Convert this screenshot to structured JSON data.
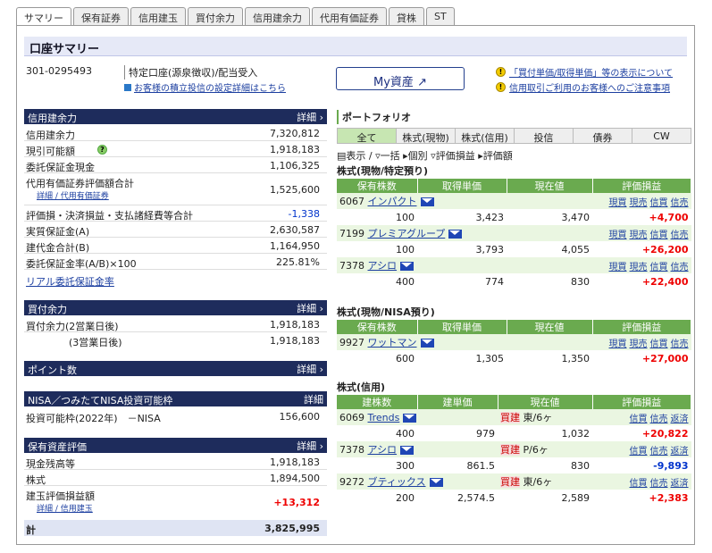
{
  "tabs": [
    "サマリー",
    "保有証券",
    "信用建玉",
    "買付余力",
    "信用建余力",
    "代用有価証券",
    "貸株",
    "ST"
  ],
  "title": "口座サマリー",
  "account": {
    "number": "301-0295493",
    "tax": "特定口座(源泉徴収)/配当受入",
    "tax_link": "お客様の積立投信の設定詳細はこちら"
  },
  "myasset": "My資産",
  "notes": [
    "「買付単価/取得単価」等の表示について",
    "信用取引ご利用のお客様へのご注意事項"
  ],
  "detail": "詳細",
  "margin": {
    "header": "信用建余力",
    "rows": [
      {
        "label": "信用建余力",
        "value": "7,320,812"
      },
      {
        "label": "現引可能額",
        "value": "1,918,183"
      },
      {
        "label": "委託保証金現金",
        "value": "1,106,325"
      },
      {
        "label": "代用有価証券評価額合計",
        "value": "1,525,600",
        "sub": "詳細 / 代用有価証券"
      },
      {
        "label": "評価損・決済損益・支払諸経費等合計",
        "value": "-1,338"
      },
      {
        "label": "実質保証金(A)",
        "value": "2,630,587"
      },
      {
        "label": "建代金合計(B)",
        "value": "1,164,950"
      },
      {
        "label": "委託保証金率(A/B)×100",
        "value": "225.81%"
      }
    ],
    "link": "リアル委託保証金率"
  },
  "buying": {
    "header": "買付余力",
    "rows": [
      {
        "label": "買付余力(2営業日後)",
        "value": "1,918,183"
      },
      {
        "label": "(3営業日後)",
        "value": "1,918,183"
      }
    ]
  },
  "points": {
    "header": "ポイント数"
  },
  "nisa": {
    "header": "NISA／つみたてNISA投資可能枠",
    "label": "投資可能枠(2022年)　－NISA",
    "value": "156,600"
  },
  "assets": {
    "header": "保有資産評価",
    "rows": [
      {
        "label": "現金残高等",
        "value": "1,918,183"
      },
      {
        "label": "株式",
        "value": "1,894,500"
      },
      {
        "label": "建玉評価損益額",
        "value": "+13,312",
        "sub": "詳細 / 信用建玉"
      }
    ],
    "total_label": "計",
    "total": "3,825,995"
  },
  "portfolio": {
    "title": "ポートフォリオ",
    "tabs": [
      "全て",
      "株式(現物)",
      "株式(信用)",
      "投信",
      "債券",
      "CW"
    ],
    "tools": [
      "表示",
      "一括",
      "個別",
      "評価損益",
      "評価額"
    ],
    "spot_title": "株式(現物/特定預り)",
    "nisa_title": "株式(現物/NISA預り)",
    "credit_title": "株式(信用)",
    "spot_headers": [
      "保有株数",
      "取得単価",
      "現在値",
      "評価損益"
    ],
    "credit_headers": [
      "建株数",
      "建単価",
      "現在値",
      "評価損益"
    ],
    "spot": [
      {
        "code": "6067",
        "name": "インパクト",
        "qty": "100",
        "cost": "3,423",
        "price": "3,470",
        "pl": "+4,700"
      },
      {
        "code": "7199",
        "name": "プレミアグループ",
        "qty": "100",
        "cost": "3,793",
        "price": "4,055",
        "pl": "+26,200"
      },
      {
        "code": "7378",
        "name": "アシロ",
        "qty": "400",
        "cost": "774",
        "price": "830",
        "pl": "+22,400"
      }
    ],
    "nisa": [
      {
        "code": "9927",
        "name": "ワットマン",
        "qty": "600",
        "cost": "1,305",
        "price": "1,350",
        "pl": "+27,000"
      }
    ],
    "credit": [
      {
        "code": "6069",
        "name": "Trends",
        "side": "買建",
        "term": "東/6ヶ",
        "qty": "400",
        "cost": "979",
        "price": "1,032",
        "pl": "+20,822"
      },
      {
        "code": "7378",
        "name": "アシロ",
        "side": "買建",
        "term": "P/6ヶ",
        "qty": "300",
        "cost": "861.5",
        "price": "830",
        "pl": "-9,893"
      },
      {
        "code": "9272",
        "name": "ブティックス",
        "side": "買建",
        "term": "東/6ヶ",
        "qty": "200",
        "cost": "2,574.5",
        "price": "2,589",
        "pl": "+2,383"
      }
    ],
    "spot_actions": [
      "現買",
      "現売",
      "信買",
      "信売"
    ],
    "credit_actions": [
      "信買",
      "信売",
      "返済"
    ]
  }
}
